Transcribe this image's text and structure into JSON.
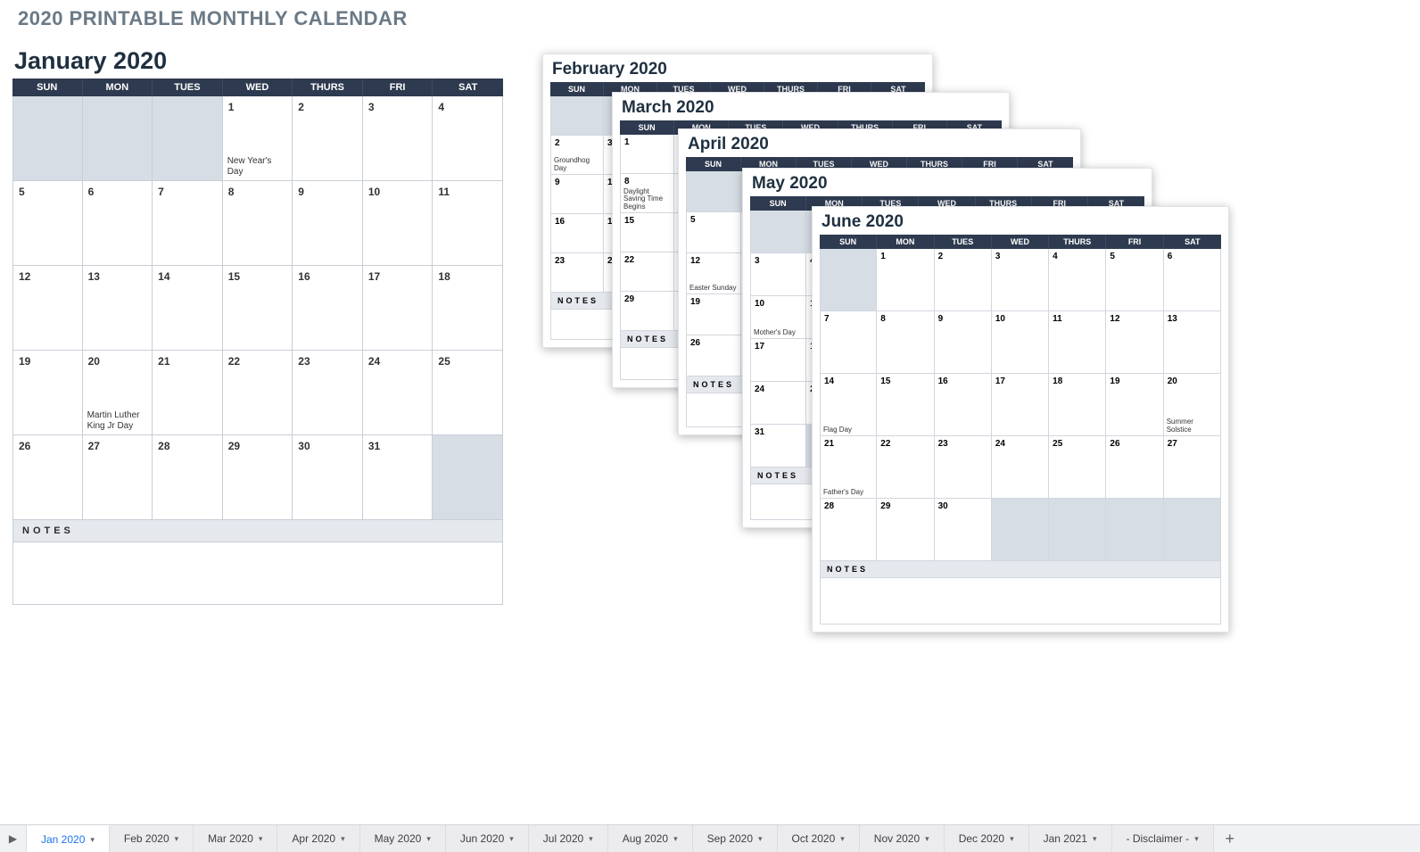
{
  "heading": "2020 PRINTABLE MONTHLY CALENDAR",
  "notes_label": "NOTES",
  "day_headers": [
    "SUN",
    "MON",
    "TUES",
    "WED",
    "THURS",
    "FRI",
    "SAT"
  ],
  "main_month": {
    "title": "January 2020",
    "lead_blank": 3,
    "trail_blank": 1,
    "days": 31,
    "events": {
      "1": "New Year's Day",
      "20": "Martin Luther King Jr Day"
    }
  },
  "mini_months": [
    {
      "id": "feb",
      "title": "February 2020",
      "lead_blank": 6,
      "trail_blank": 0,
      "days": 29,
      "events": {
        "2": "Groundhog Day"
      }
    },
    {
      "id": "mar",
      "title": "March 2020",
      "lead_blank": 0,
      "trail_blank": 4,
      "days": 31,
      "events": {
        "8": "Daylight Saving Time Begins"
      }
    },
    {
      "id": "apr",
      "title": "April 2020",
      "lead_blank": 3,
      "trail_blank": 2,
      "days": 30,
      "events": {
        "12": "Easter Sunday"
      }
    },
    {
      "id": "may",
      "title": "May 2020",
      "lead_blank": 5,
      "trail_blank": 6,
      "days": 31,
      "events": {
        "10": "Mother's Day"
      }
    },
    {
      "id": "jun",
      "title": "June 2020",
      "lead_blank": 1,
      "trail_blank": 4,
      "days": 30,
      "events": {
        "14": "Flag Day",
        "20": "Summer Solstice",
        "21": "Father's Day"
      }
    }
  ],
  "tabs": [
    "Jan 2020",
    "Feb 2020",
    "Mar 2020",
    "Apr 2020",
    "May 2020",
    "Jun 2020",
    "Jul 2020",
    "Aug 2020",
    "Sep 2020",
    "Oct 2020",
    "Nov 2020",
    "Dec 2020",
    "Jan 2021",
    "- Disclaimer -"
  ],
  "active_tab": "Jan 2020"
}
